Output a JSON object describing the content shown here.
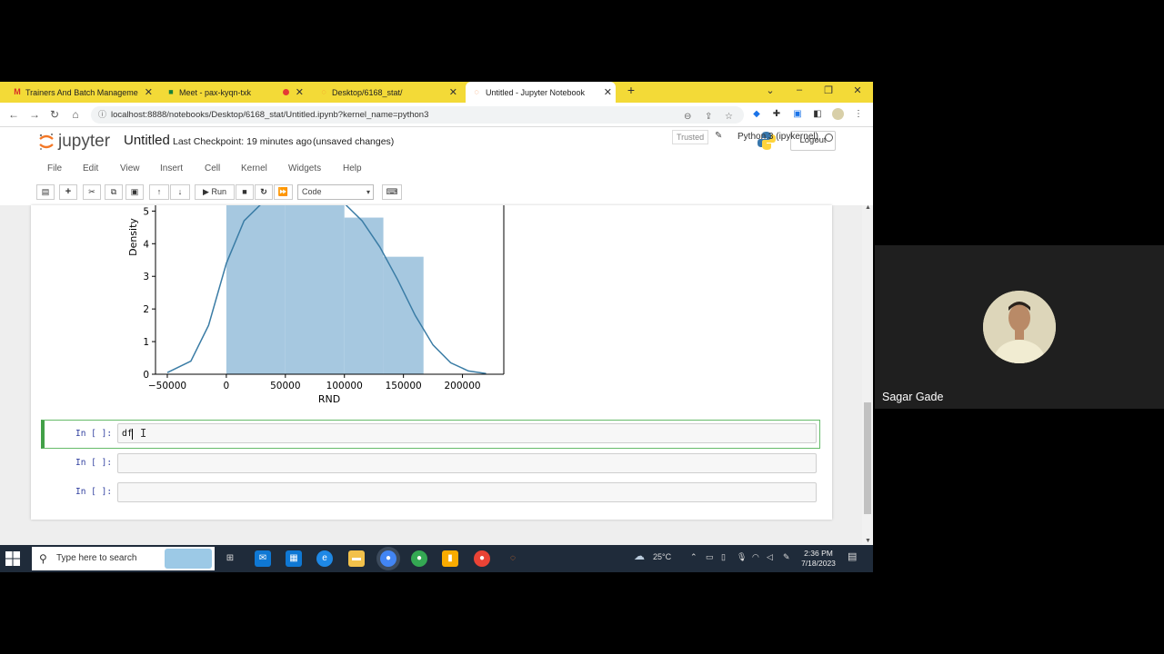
{
  "browser": {
    "tabs": [
      {
        "title": "Trainers And Batch Management",
        "icon": "gmail-icon"
      },
      {
        "title": "Meet - pax-kyqn-txk",
        "icon": "meet-icon"
      },
      {
        "title": "Desktop/6168_stat/",
        "icon": "jupyter-icon"
      },
      {
        "title": "Untitled - Jupyter Notebook",
        "icon": "jupyter-icon",
        "active": true
      }
    ],
    "url": "localhost:8888/notebooks/Desktop/6168_stat/Untitled.ipynb?kernel_name=python3"
  },
  "jupyter": {
    "logo_text": "jupyter",
    "notebook_name": "Untitled",
    "checkpoint": "Last Checkpoint: 19 minutes ago",
    "unsaved": "(unsaved changes)",
    "logout": "Logout",
    "menu": [
      "File",
      "Edit",
      "View",
      "Insert",
      "Cell",
      "Kernel",
      "Widgets",
      "Help"
    ],
    "trusted": "Trusted",
    "kernel": "Python 3 (ipykernel)",
    "run_label": "Run",
    "cell_type": "Code"
  },
  "chart_data": {
    "type": "bar",
    "xlabel": "RND",
    "ylabel": "Density",
    "x_ticks": [
      "−50000",
      "0",
      "50000",
      "100000",
      "150000",
      "200000"
    ],
    "y_ticks": [
      "0",
      "1",
      "2",
      "3",
      "4",
      "5"
    ],
    "xlim": [
      -60000,
      235000
    ],
    "ylim": [
      0,
      5.4
    ],
    "histogram": {
      "bin_edges": [
        0,
        50000,
        100000,
        133000,
        167000
      ],
      "density": [
        5.5,
        5.5,
        4.8,
        3.6
      ],
      "color": "#a6c8e0"
    },
    "kde": {
      "x": [
        -50000,
        -30000,
        -15000,
        0,
        15000,
        30000,
        45000,
        60000,
        80000,
        100000,
        115000,
        130000,
        145000,
        160000,
        175000,
        190000,
        205000,
        220000
      ],
      "y": [
        0.05,
        0.4,
        1.5,
        3.4,
        4.7,
        5.4,
        5.7,
        5.7,
        5.5,
        5.3,
        4.7,
        3.9,
        2.9,
        1.8,
        0.9,
        0.35,
        0.1,
        0.02
      ],
      "color": "#3a7ca5"
    }
  },
  "cells": [
    {
      "prompt": "In [ ]:",
      "code": "df"
    },
    {
      "prompt": "In [ ]:",
      "code": ""
    },
    {
      "prompt": "In [ ]:",
      "code": ""
    }
  ],
  "taskbar": {
    "search_placeholder": "Type here to search",
    "weather": "25°C",
    "time": "2:36 PM",
    "date": "7/18/2023"
  },
  "meet": {
    "participant": "Sagar Gade"
  }
}
